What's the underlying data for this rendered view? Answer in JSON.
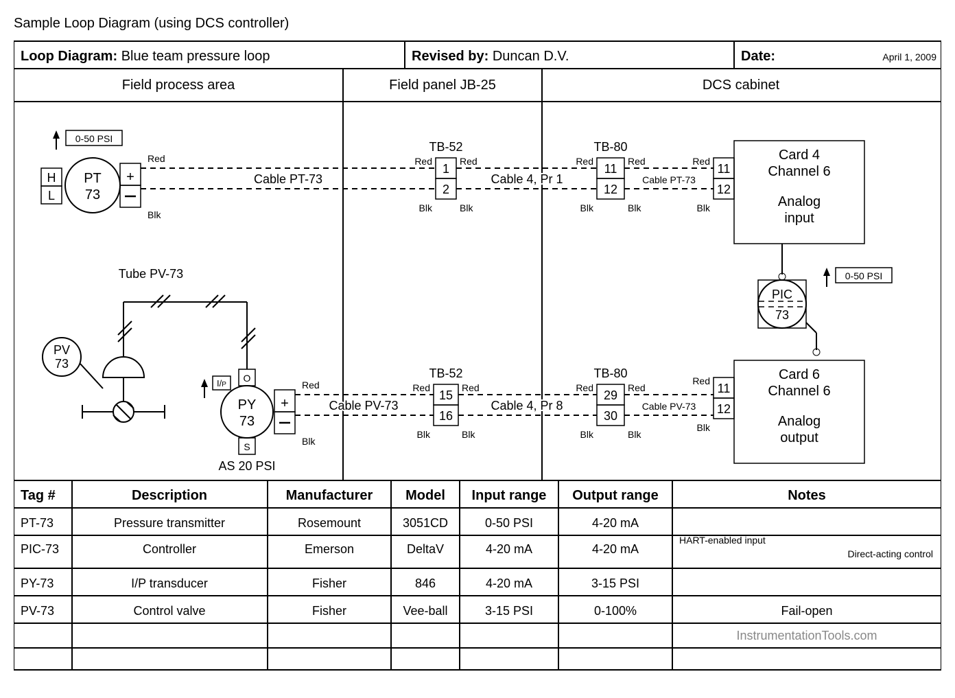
{
  "title": "Sample Loop Diagram (using DCS controller)",
  "header": {
    "loopLabel": "Loop Diagram:",
    "loopName": "Blue team pressure loop",
    "revisedLabel": "Revised by:",
    "revisedBy": "Duncan D.V.",
    "dateLabel": "Date:",
    "date": "April 1, 2009"
  },
  "areas": {
    "field": "Field process area",
    "panel": "Field panel JB-25",
    "dcs": "DCS cabinet"
  },
  "pt": {
    "tag1": "PT",
    "tag2": "73",
    "h": "H",
    "l": "L",
    "range": "0-50 PSI",
    "red": "Red",
    "blk": "Blk",
    "cable": "Cable PT-73",
    "cableShort": "Cable PT-73"
  },
  "tb52": {
    "name": "TB-52",
    "a": "1",
    "b": "2",
    "c": "15",
    "d": "16"
  },
  "tb80": {
    "name": "TB-80",
    "a": "11",
    "b": "12",
    "c": "29",
    "d": "30"
  },
  "pair1": "Cable 4, Pr 1",
  "pair8": "Cable 4, Pr 8",
  "card4": {
    "l1": "Card 4",
    "l2": "Channel 6",
    "l3": "Analog",
    "l4": "input",
    "t1": "11",
    "t2": "12"
  },
  "card6": {
    "l1": "Card 6",
    "l2": "Channel 6",
    "l3": "Analog",
    "l4": "output",
    "t1": "11",
    "t2": "12"
  },
  "pic": {
    "tag1": "PIC",
    "tag2": "73",
    "range": "0-50 PSI"
  },
  "pv": {
    "tag1": "PV",
    "tag2": "73",
    "tube": "Tube PV-73"
  },
  "py": {
    "tag1": "PY",
    "tag2": "73",
    "o": "O",
    "s": "S",
    "ip": "I/P",
    "as": "AS 20 PSI",
    "cable": "Cable PV-73",
    "cableShort": "Cable PV-73"
  },
  "table": {
    "headers": [
      "Tag #",
      "Description",
      "Manufacturer",
      "Model",
      "Input range",
      "Output range",
      "Notes"
    ],
    "rows": [
      [
        "PT-73",
        "Pressure transmitter",
        "Rosemount",
        "3051CD",
        "0-50 PSI",
        "4-20 mA",
        ""
      ],
      [
        "PIC-73",
        "Controller",
        "Emerson",
        "DeltaV",
        "4-20 mA",
        "4-20 mA",
        "HART-enabled input\nDirect-acting control"
      ],
      [
        "PY-73",
        "I/P transducer",
        "Fisher",
        "846",
        "4-20 mA",
        "3-15 PSI",
        ""
      ],
      [
        "PV-73",
        "Control valve",
        "Fisher",
        "Vee-ball",
        "3-15 PSI",
        "0-100%",
        "Fail-open"
      ],
      [
        "",
        "",
        "",
        "",
        "",
        "",
        "InstrumentationTools.com"
      ]
    ]
  }
}
